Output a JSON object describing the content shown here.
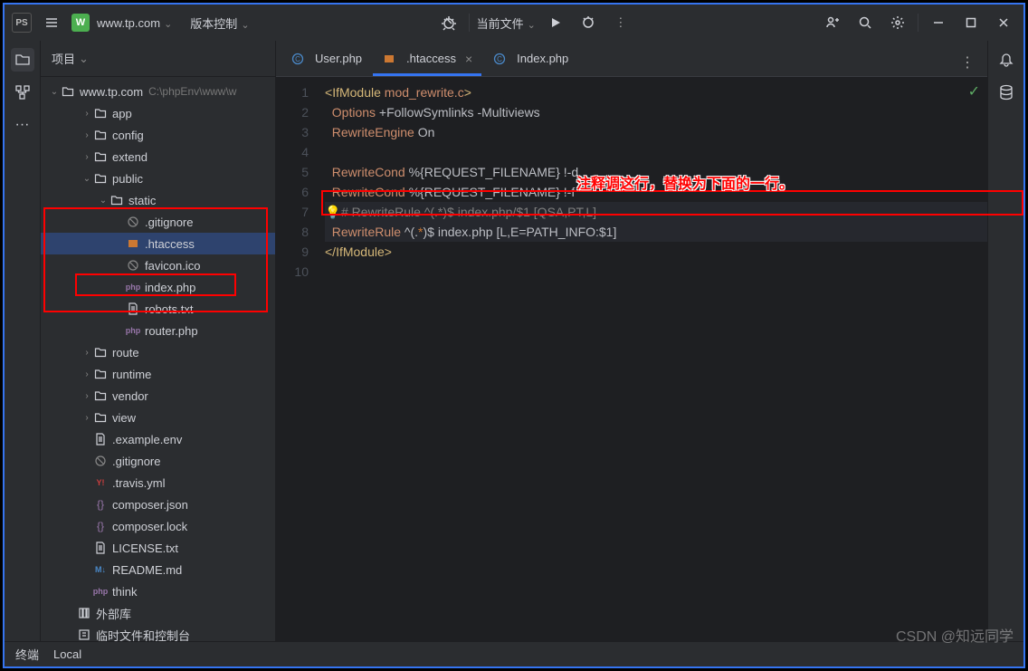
{
  "titlebar": {
    "project": "www.tp.com",
    "vcs": "版本控制",
    "run_config": "当前文件"
  },
  "sidebar": {
    "title": "项目",
    "root": {
      "name": "www.tp.com",
      "path": "C:\\phpEnv\\www\\w"
    }
  },
  "tree": [
    {
      "name": "app",
      "depth": 2,
      "type": "folder",
      "arrow": ">"
    },
    {
      "name": "config",
      "depth": 2,
      "type": "folder",
      "arrow": ">"
    },
    {
      "name": "extend",
      "depth": 2,
      "type": "folder",
      "arrow": ">"
    },
    {
      "name": "public",
      "depth": 2,
      "type": "folder",
      "arrow": "v"
    },
    {
      "name": "static",
      "depth": 3,
      "type": "folder",
      "arrow": "v"
    },
    {
      "name": ".gitignore",
      "depth": 4,
      "type": "gitignore"
    },
    {
      "name": ".htaccess",
      "depth": 4,
      "type": "htaccess",
      "selected": true
    },
    {
      "name": "favicon.ico",
      "depth": 4,
      "type": "favicon"
    },
    {
      "name": "index.php",
      "depth": 4,
      "type": "php"
    },
    {
      "name": "robots.txt",
      "depth": 4,
      "type": "txt"
    },
    {
      "name": "router.php",
      "depth": 4,
      "type": "php"
    },
    {
      "name": "route",
      "depth": 2,
      "type": "folder",
      "arrow": ">"
    },
    {
      "name": "runtime",
      "depth": 2,
      "type": "folder",
      "arrow": ">"
    },
    {
      "name": "vendor",
      "depth": 2,
      "type": "folder",
      "arrow": ">"
    },
    {
      "name": "view",
      "depth": 2,
      "type": "folder",
      "arrow": ">"
    },
    {
      "name": ".example.env",
      "depth": 2,
      "type": "env"
    },
    {
      "name": ".gitignore",
      "depth": 2,
      "type": "gitignore"
    },
    {
      "name": ".travis.yml",
      "depth": 2,
      "type": "yml"
    },
    {
      "name": "composer.json",
      "depth": 2,
      "type": "json"
    },
    {
      "name": "composer.lock",
      "depth": 2,
      "type": "json"
    },
    {
      "name": "LICENSE.txt",
      "depth": 2,
      "type": "txt"
    },
    {
      "name": "README.md",
      "depth": 2,
      "type": "md"
    },
    {
      "name": "think",
      "depth": 2,
      "type": "php"
    },
    {
      "name": "外部库",
      "depth": 1,
      "type": "lib"
    },
    {
      "name": "临时文件和控制台",
      "depth": 1,
      "type": "scratch"
    }
  ],
  "tabs": [
    {
      "label": "User.php",
      "icon": "class",
      "active": false
    },
    {
      "label": ".htaccess",
      "icon": "htaccess",
      "active": true
    },
    {
      "label": "Index.php",
      "icon": "class",
      "active": false
    }
  ],
  "code": {
    "l1": {
      "b1": "<",
      "b2": "IfModule",
      "b3": " mod_rewrite.c",
      "b4": ">"
    },
    "l2": {
      "a": "Options",
      "b": " +FollowSymlinks -Multiviews"
    },
    "l3": {
      "a": "RewriteEngine",
      "b": " On"
    },
    "l5": {
      "a": "RewriteCond",
      "b": " %{REQUEST_FILENAME} !-d"
    },
    "l6": {
      "a": "RewriteCond",
      "b": " %{REQUEST_FILENAME} !-f"
    },
    "l7": "# RewriteRule ^(.*)$ index.php/$1 [QSA,PT,L]",
    "l8": {
      "a": "RewriteRule",
      "b": " ^(.",
      "c": "*",
      "d": ")$ index.php [L,E=PATH_INFO:$1]"
    },
    "l9": {
      "b1": "</",
      "b2": "IfModule",
      "b3": ">"
    }
  },
  "annotation": "注释调这行，替换为下面的一行。",
  "bottom": {
    "terminal": "终端",
    "local": "Local"
  },
  "watermark": "CSDN @知远同学"
}
